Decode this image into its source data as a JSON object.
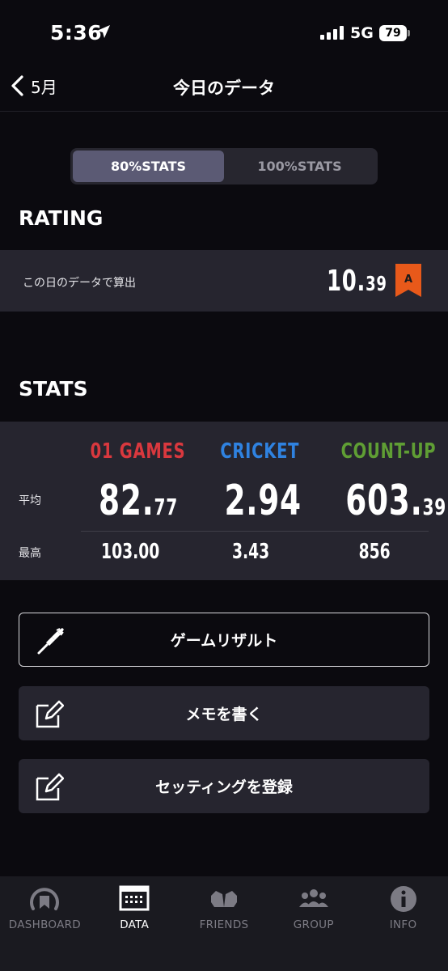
{
  "status_bar": {
    "time": "5:36",
    "network": "5G",
    "battery": "79"
  },
  "nav": {
    "back_label": "5月",
    "title": "今日のデータ"
  },
  "segment": {
    "options": [
      "80%STATS",
      "100%STATS"
    ],
    "selected": "80%STATS"
  },
  "rating": {
    "section_title": "RATING",
    "label": "この日のデータで算出",
    "value_int": "10.",
    "value_dec": "39",
    "badge": "A"
  },
  "stats": {
    "section_title": "STATS",
    "columns": [
      {
        "header": "01 GAMES",
        "color": "#d9383e",
        "avg_int": "82.",
        "avg_dec": "77",
        "max": "103.00"
      },
      {
        "header": "CRICKET",
        "color": "#2f82e0",
        "avg_int": "2.94",
        "avg_dec": "",
        "max": "3.43"
      },
      {
        "header": "COUNT-UP",
        "color": "#5f9e34",
        "avg_int": "603.",
        "avg_dec": "39",
        "max": "856"
      }
    ],
    "avg_label": "平均",
    "max_label": "最高"
  },
  "actions": {
    "game_result": "ゲームリザルト",
    "write_memo": "メモを書く",
    "register_setting": "セッティングを登録"
  },
  "tab_bar": {
    "tabs": [
      {
        "label": "DASHBOARD",
        "icon": "dashboard-icon"
      },
      {
        "label": "DATA",
        "icon": "data-icon"
      },
      {
        "label": "FRIENDS",
        "icon": "friends-icon"
      },
      {
        "label": "GROUP",
        "icon": "group-icon"
      },
      {
        "label": "INFO",
        "icon": "info-icon"
      }
    ],
    "active": "DATA"
  },
  "colors": {
    "badge": "#e8591a",
    "panel": "#26252f",
    "background": "#0b0a0f"
  }
}
